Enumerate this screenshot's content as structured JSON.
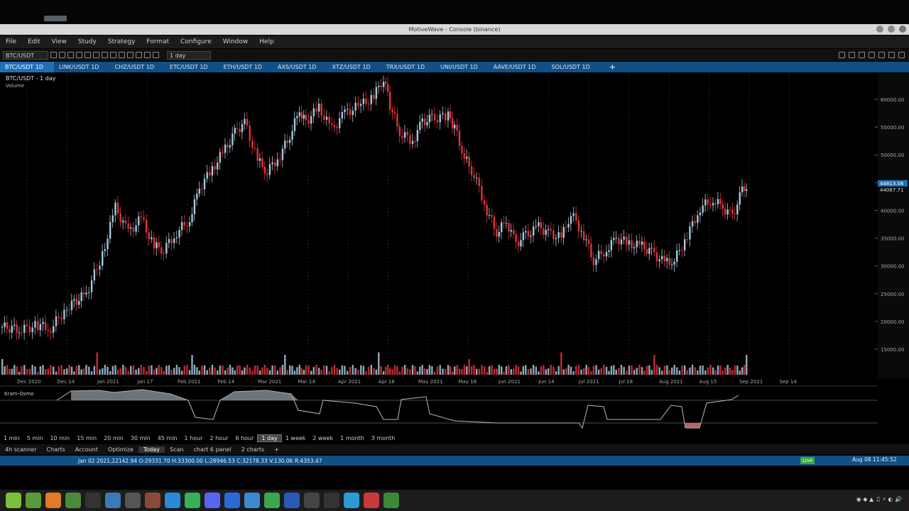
{
  "window": {
    "title": "MotiveWave - Console (binance)"
  },
  "menu": [
    "File",
    "Edit",
    "View",
    "Study",
    "Strategy",
    "Format",
    "Configure",
    "Window",
    "Help"
  ],
  "toolbar": {
    "symbol": "BTC/USDT",
    "interval": "1 day"
  },
  "chart_tabs": [
    "BTC/USDT 1D",
    "LINK/USDT 1D",
    "CHZ/USDT 1D",
    "ETC/USDT 1D",
    "ETH/USDT 1D",
    "AXS/USDT 1D",
    "XTZ/USDT 1D",
    "TRX/USDT 1D",
    "UNI/USDT 1D",
    "AAVE/USDT 1D",
    "SOL/USDT 1D"
  ],
  "chart": {
    "label": "BTC/USDT - 1 day",
    "volume_label": "Volume",
    "osc_label": "Kram-Osmo",
    "price_ticks": [
      "60000.00",
      "55000.00",
      "50000.00",
      "45000.00",
      "40000.00",
      "35000.00",
      "30000.00",
      "25000.00",
      "20000.00",
      "15000.00"
    ],
    "date_ticks": [
      "Dec 2020",
      "Dec 14",
      "Jan 2021",
      "Jan 17",
      "Feb 2021",
      "Feb 14",
      "Mar 2021",
      "Mar 14",
      "Apr 2021",
      "Apr 18",
      "May 2021",
      "May 16",
      "Jun 2021",
      "Jun 14",
      "Jul 2021",
      "Jul 18",
      "Aug 2021",
      "Aug 15",
      "Sep 2021",
      "Sep 14"
    ],
    "last_price": "44813.06",
    "last_price2": "44067.71",
    "up_color": "#a8c8dc",
    "down_color": "#e0343c"
  },
  "intervals": [
    "1 min",
    "5 min",
    "10 min",
    "15 min",
    "20 min",
    "30 min",
    "45 min",
    "1 hour",
    "2 hour",
    "6 hour",
    "1 day",
    "1 week",
    "2 week",
    "1 month",
    "3 month"
  ],
  "active_interval": "1 day",
  "workspace_tabs": [
    "4h scanner",
    "Charts",
    "Account",
    "Optimize",
    "Today",
    "Scan",
    "chart 6 panel",
    "2 charts",
    "+"
  ],
  "status": {
    "ohlc": "Jan 02 2021,22142.94 O:29331.70 H:33300.00 L:28946.53 C:32178.33 V:130.0K R:4353.47",
    "live": "Live",
    "time": "Aug 08 11:45:52"
  }
}
